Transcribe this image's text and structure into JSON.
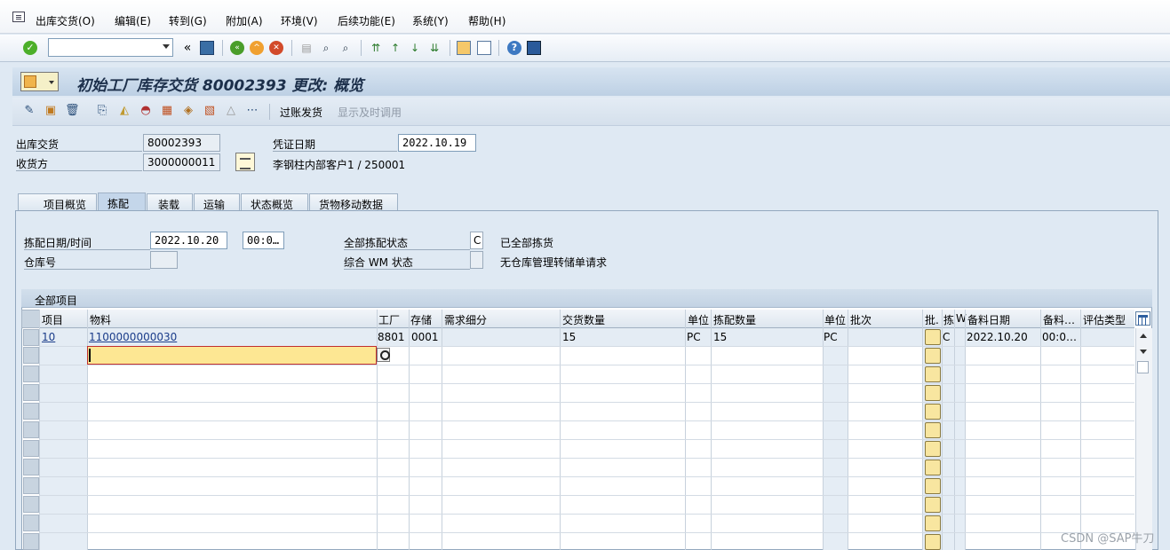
{
  "menubar": {
    "items": [
      "出库交货(O)",
      "编辑(E)",
      "转到(G)",
      "附加(A)",
      "环境(V)",
      "后续功能(E)",
      "系统(Y)",
      "帮助(H)"
    ]
  },
  "toolbar": {
    "command_value": "",
    "back_symbol": "«"
  },
  "title": {
    "text": "初始工厂库存交货 80002393 更改: 概览"
  },
  "app_toolbar": {
    "post_goods_issue": "过账发货",
    "display_timely_call": "显示及时调用"
  },
  "header": {
    "outbound_delivery_label": "出库交货",
    "outbound_delivery_value": "80002393",
    "document_date_label": "凭证日期",
    "document_date_value": "2022.10.19",
    "ship_to_label": "收货方",
    "ship_to_value": "3000000011",
    "ship_to_name": "李钢柱内部客户1 / 250001"
  },
  "tabs": [
    "项目概览",
    "拣配",
    "装载",
    "运输",
    "状态概览",
    "货物移动数据"
  ],
  "active_tab": "拣配",
  "picking": {
    "date_time_label": "拣配日期/时间",
    "date_value": "2022.10.20",
    "time_value": "00:0…",
    "overall_status_label": "全部拣配状态",
    "overall_status_value": "C",
    "overall_status_text": "已全部拣货",
    "warehouse_label": "仓库号",
    "warehouse_value": "",
    "wm_status_label": "综合 WM 状态",
    "wm_status_value": "",
    "wm_status_text": "无仓库管理转储单请求"
  },
  "grid": {
    "title": "全部项目",
    "columns": [
      "项目",
      "物料",
      "工厂",
      "存储",
      "需求细分",
      "交货数量",
      "单位",
      "拣配数量",
      "单位",
      "批次",
      "批.",
      "拣",
      "W",
      "备料日期",
      "备料…",
      "评估类型"
    ],
    "rows": [
      {
        "item": "10",
        "material": "1100000000030",
        "plant": "8801",
        "storage": "0001",
        "requirement_segment": "",
        "delivery_qty": "15",
        "unit": "PC",
        "picked_qty": "15",
        "picked_unit": "PC",
        "batch": "",
        "pick_status": "C",
        "staging_date": "2022.10.20",
        "staging_time": "00:0…",
        "valuation_type": ""
      }
    ],
    "input_row": {
      "material": ""
    }
  },
  "watermark": "CSDN @SAP牛刀",
  "colors": {
    "title_bg": "#bdd0e4",
    "input_highlight": "#fde793",
    "confirm_green": "#4caf2a"
  }
}
